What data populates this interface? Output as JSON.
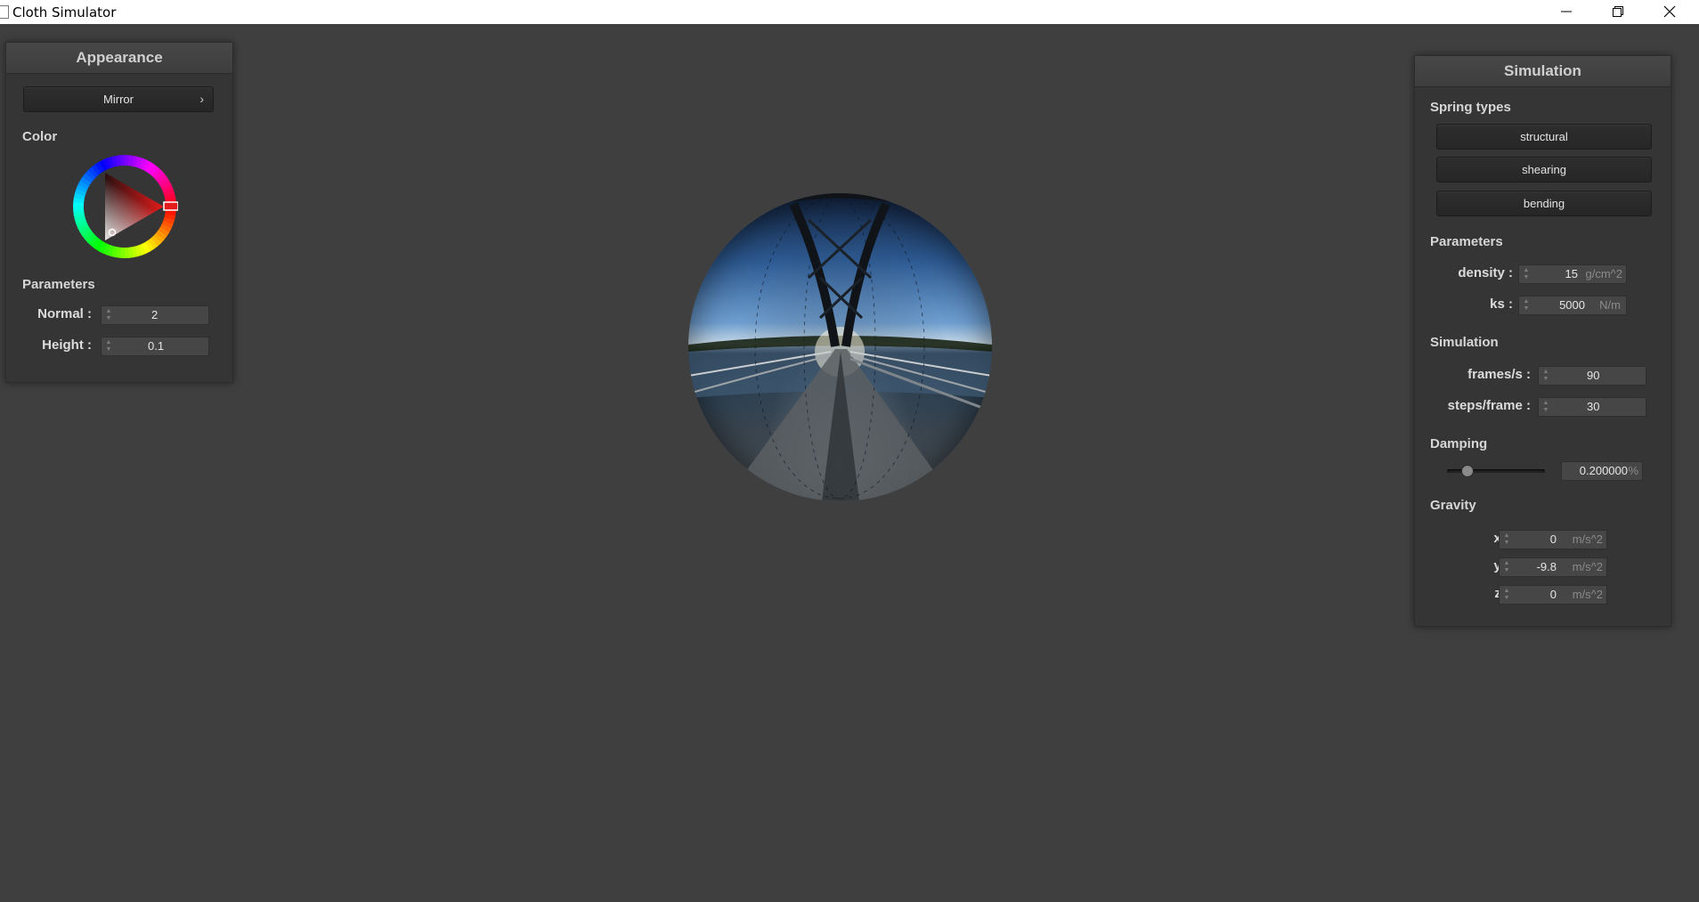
{
  "window": {
    "title": "Cloth Simulator"
  },
  "appearance": {
    "header": "Appearance",
    "shader_button": "Mirror",
    "color_label": "Color",
    "color_wheel_hue": "#e31b1b",
    "parameters_label": "Parameters",
    "fields": [
      {
        "label": "Normal :",
        "value": "2"
      },
      {
        "label": "Height :",
        "value": "0.1"
      }
    ]
  },
  "simulation": {
    "header": "Simulation",
    "spring_types_label": "Spring types",
    "spring_buttons": [
      "structural",
      "shearing",
      "bending"
    ],
    "parameters_label": "Parameters",
    "parameters": [
      {
        "label": "density :",
        "value": "15",
        "unit": "g/cm^2"
      },
      {
        "label": "ks :",
        "value": "5000",
        "unit": "N/m"
      }
    ],
    "simulation_label": "Simulation",
    "simulation_fields": [
      {
        "label": "frames/s :",
        "value": "90"
      },
      {
        "label": "steps/frame :",
        "value": "30"
      }
    ],
    "damping_label": "Damping",
    "damping": {
      "value": "0.200000",
      "unit": "%",
      "slider_fraction": 0.2
    },
    "gravity_label": "Gravity",
    "gravity": [
      {
        "label": "x :",
        "value": "0",
        "unit": "m/s^2"
      },
      {
        "label": "y :",
        "value": "-9.8",
        "unit": "m/s^2"
      },
      {
        "label": "z :",
        "value": "0",
        "unit": "m/s^2"
      }
    ]
  },
  "viewport": {
    "object": "mirror-sphere",
    "environment": "bridge-over-lake"
  }
}
